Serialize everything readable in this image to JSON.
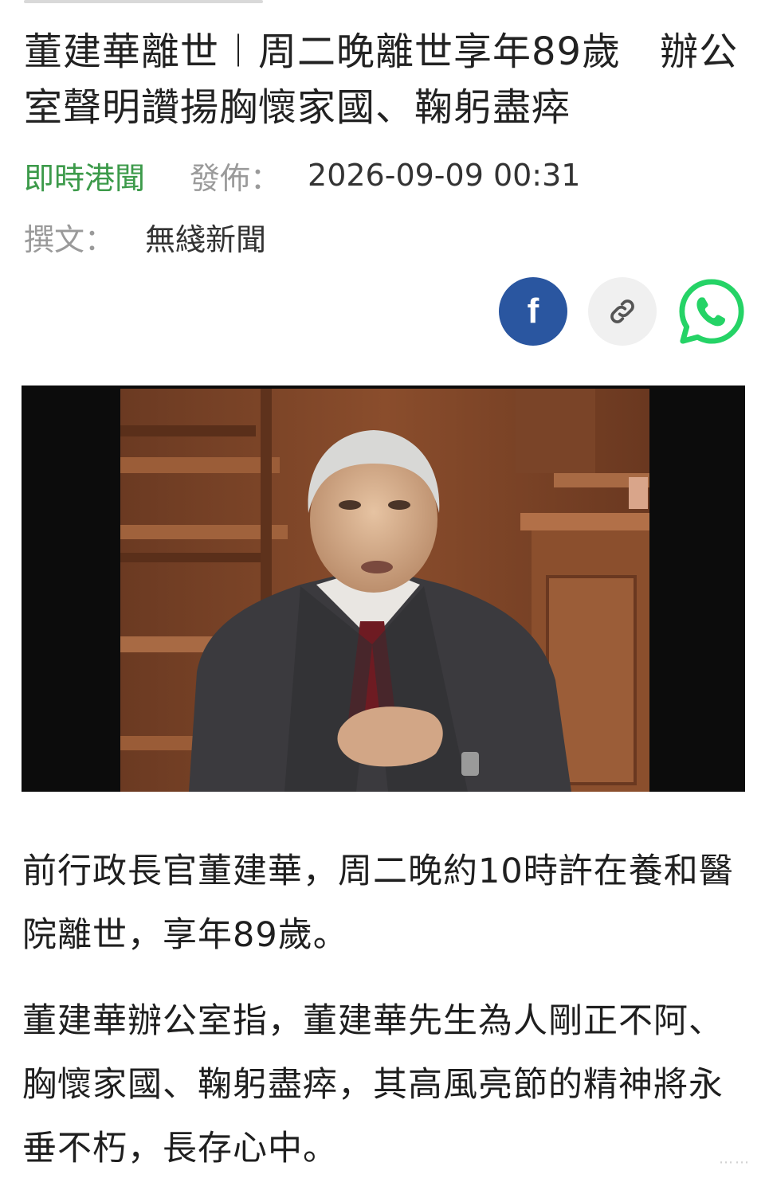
{
  "article": {
    "headline": "董建華離世︱周二晚離世享年89歲　辦公室聲明讚揚胸懷家國、鞠躬盡瘁",
    "source": "即時港聞",
    "published_label": "發佈：",
    "published_datetime": "2026-09-09 00:31",
    "author_label": "撰文：",
    "author": "無綫新聞",
    "paragraphs": [
      "前行政長官董建華，周二晚約10時許在養和醫院離世，享年89歲。",
      "董建華辦公室指，董建華先生為人剛正不阿、胸懷家國、鞠躬盡瘁，其高風亮節的精神將永垂不朽，長存心中。"
    ]
  },
  "share": {
    "facebook_glyph": "f",
    "icons": [
      "facebook-icon",
      "link-icon",
      "whatsapp-icon"
    ]
  },
  "colors": {
    "source_green": "#3c9a4a",
    "facebook_blue": "#2a56a0",
    "whatsapp_green": "#25d366"
  }
}
